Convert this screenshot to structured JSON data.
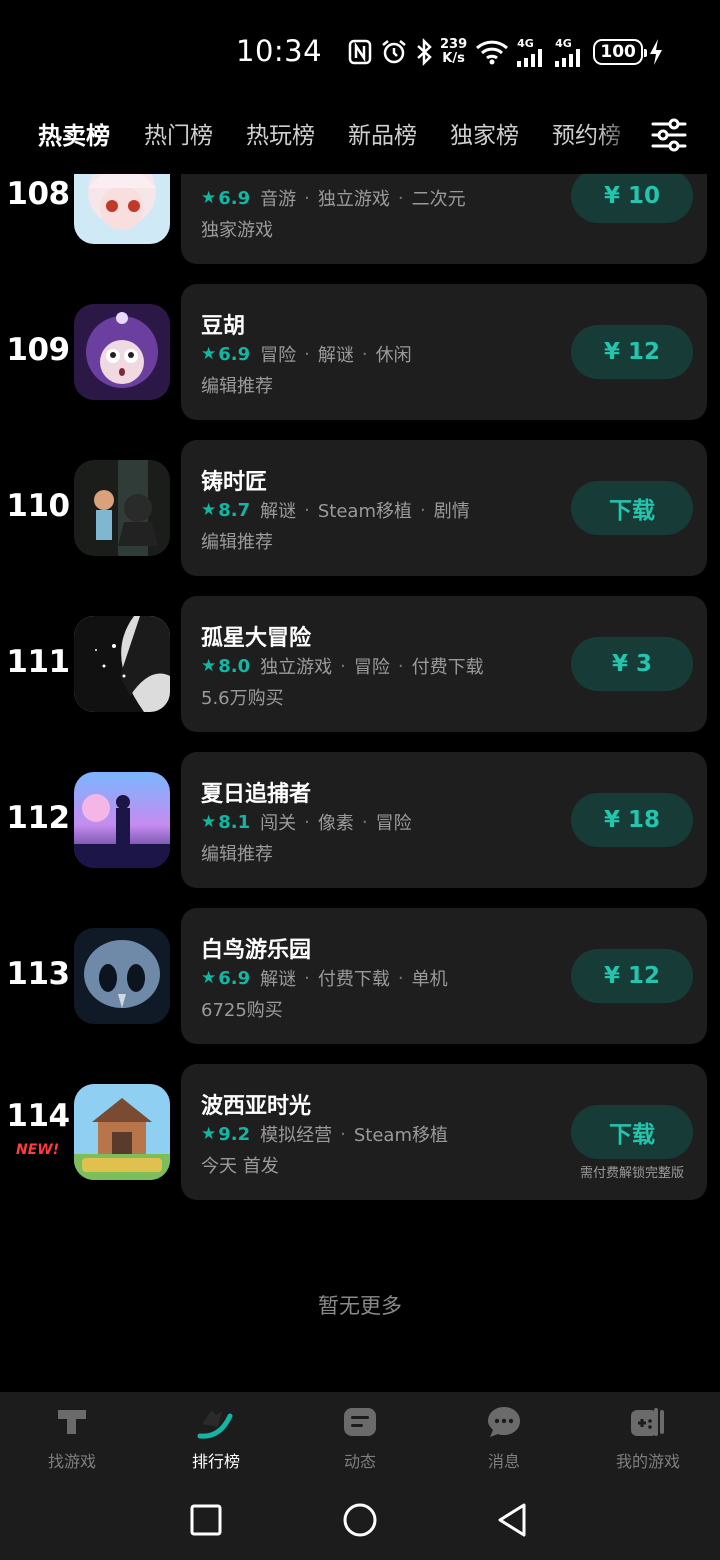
{
  "status_bar": {
    "time": "10:34",
    "net_speed_value": "239",
    "net_speed_unit": "K/s",
    "net_label_1": "4G",
    "net_label_2": "4G",
    "battery": "100",
    "icons": [
      "nfc-icon",
      "alarm-icon",
      "bluetooth-icon",
      "wifi-icon",
      "signal-icon",
      "signal-icon",
      "battery-icon",
      "charging-icon"
    ]
  },
  "tabs": [
    {
      "label": "热卖榜",
      "active": true
    },
    {
      "label": "热门榜",
      "active": false
    },
    {
      "label": "热玩榜",
      "active": false
    },
    {
      "label": "新品榜",
      "active": false
    },
    {
      "label": "独家榜",
      "active": false
    },
    {
      "label": "预约榜",
      "active": false
    }
  ],
  "colors": {
    "accent": "#12b6a3",
    "button_bg": "#173b37",
    "button_text": "#25c4ad",
    "card_bg": "#1e1e1e",
    "new_badge": "#ff3b3b"
  },
  "games": [
    {
      "rank": "108",
      "name": "",
      "rating": "6.9",
      "tags": [
        "音游",
        "独立游戏",
        "二次元"
      ],
      "sub": "独家游戏",
      "button": "¥ 10",
      "note": "",
      "is_new": false
    },
    {
      "rank": "109",
      "name": "豆胡",
      "rating": "6.9",
      "tags": [
        "冒险",
        "解谜",
        "休闲"
      ],
      "sub": "编辑推荐",
      "button": "¥ 12",
      "note": "",
      "is_new": false
    },
    {
      "rank": "110",
      "name": "铸时匠",
      "rating": "8.7",
      "tags": [
        "解谜",
        "Steam移植",
        "剧情"
      ],
      "sub": "编辑推荐",
      "button": "下载",
      "note": "",
      "is_new": false
    },
    {
      "rank": "111",
      "name": "孤星大冒险",
      "rating": "8.0",
      "tags": [
        "独立游戏",
        "冒险",
        "付费下载"
      ],
      "sub": "5.6万购买",
      "button": "¥ 3",
      "note": "",
      "is_new": false
    },
    {
      "rank": "112",
      "name": "夏日追捕者",
      "rating": "8.1",
      "tags": [
        "闯关",
        "像素",
        "冒险"
      ],
      "sub": "编辑推荐",
      "button": "¥ 18",
      "note": "",
      "is_new": false
    },
    {
      "rank": "113",
      "name": "白鸟游乐园",
      "rating": "6.9",
      "tags": [
        "解谜",
        "付费下载",
        "单机"
      ],
      "sub": "6725购买",
      "button": "¥ 12",
      "note": "",
      "is_new": false
    },
    {
      "rank": "114",
      "name": "波西亚时光",
      "rating": "9.2",
      "tags": [
        "模拟经营",
        "Steam移植"
      ],
      "sub": "今天 首发",
      "button": "下载",
      "note": "需付费解锁完整版",
      "is_new": true,
      "new_label": "NEW!"
    }
  ],
  "footer_text": "暂无更多",
  "bottom_nav": [
    {
      "label": "找游戏",
      "icon": "find-games-icon",
      "active": false
    },
    {
      "label": "排行榜",
      "icon": "ranking-icon",
      "active": true
    },
    {
      "label": "动态",
      "icon": "feed-icon",
      "active": false
    },
    {
      "label": "消息",
      "icon": "message-icon",
      "active": false
    },
    {
      "label": "我的游戏",
      "icon": "my-games-icon",
      "active": false
    }
  ],
  "system_nav": [
    "recents-icon",
    "home-icon",
    "back-icon"
  ]
}
